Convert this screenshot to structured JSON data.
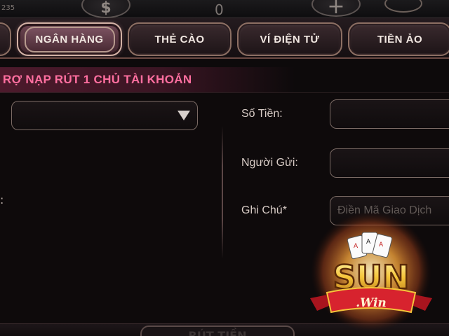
{
  "topbar": {
    "partial_number": "235",
    "zero_value": "0",
    "coin_symbol": "$",
    "plus_symbol": "+"
  },
  "tabs": [
    {
      "label": "NGÂN HÀNG",
      "active": true
    },
    {
      "label": "THẺ CÀO",
      "active": false
    },
    {
      "label": "VÍ ĐIỆN TỬ",
      "active": false
    },
    {
      "label": "TIỀN ẢO",
      "active": false
    }
  ],
  "notice": "RỢ NẠP RÚT 1 CHỦ TÀI KHOẢN",
  "form": {
    "amount_label": "Số Tiền:",
    "sender_label": "Người Gửi:",
    "note_label": "Ghi Chú*",
    "note_placeholder": "Điền Mã Giao Dịch",
    "left_colon": ":"
  },
  "bottom_button": "RÚT TIỀN",
  "logo": {
    "brand": "SUN",
    "suffix": ".Win"
  },
  "colors": {
    "notice_text": "#ff6fa0",
    "tab_border": "#8c6f63",
    "logo_gold": "#f5c53a",
    "logo_red": "#d7232e"
  }
}
